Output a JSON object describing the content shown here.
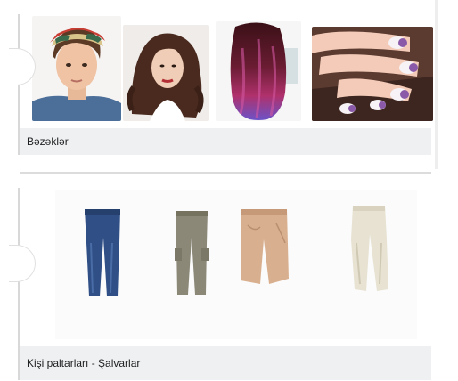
{
  "categories": [
    {
      "title": "Bəzəklər",
      "thumbnails": [
        {
          "name": "girl-headscarf-photo"
        },
        {
          "name": "curly-hair-photo"
        },
        {
          "name": "ombre-hair-photo"
        },
        {
          "name": "nail-art-photo"
        }
      ]
    },
    {
      "title": "Kişi paltarları - Şalvarlar",
      "thumbnails": [
        {
          "name": "blue-jeans-photo"
        },
        {
          "name": "cargo-pants-photo"
        },
        {
          "name": "beige-shorts-photo"
        },
        {
          "name": "cream-trousers-photo"
        }
      ]
    }
  ]
}
